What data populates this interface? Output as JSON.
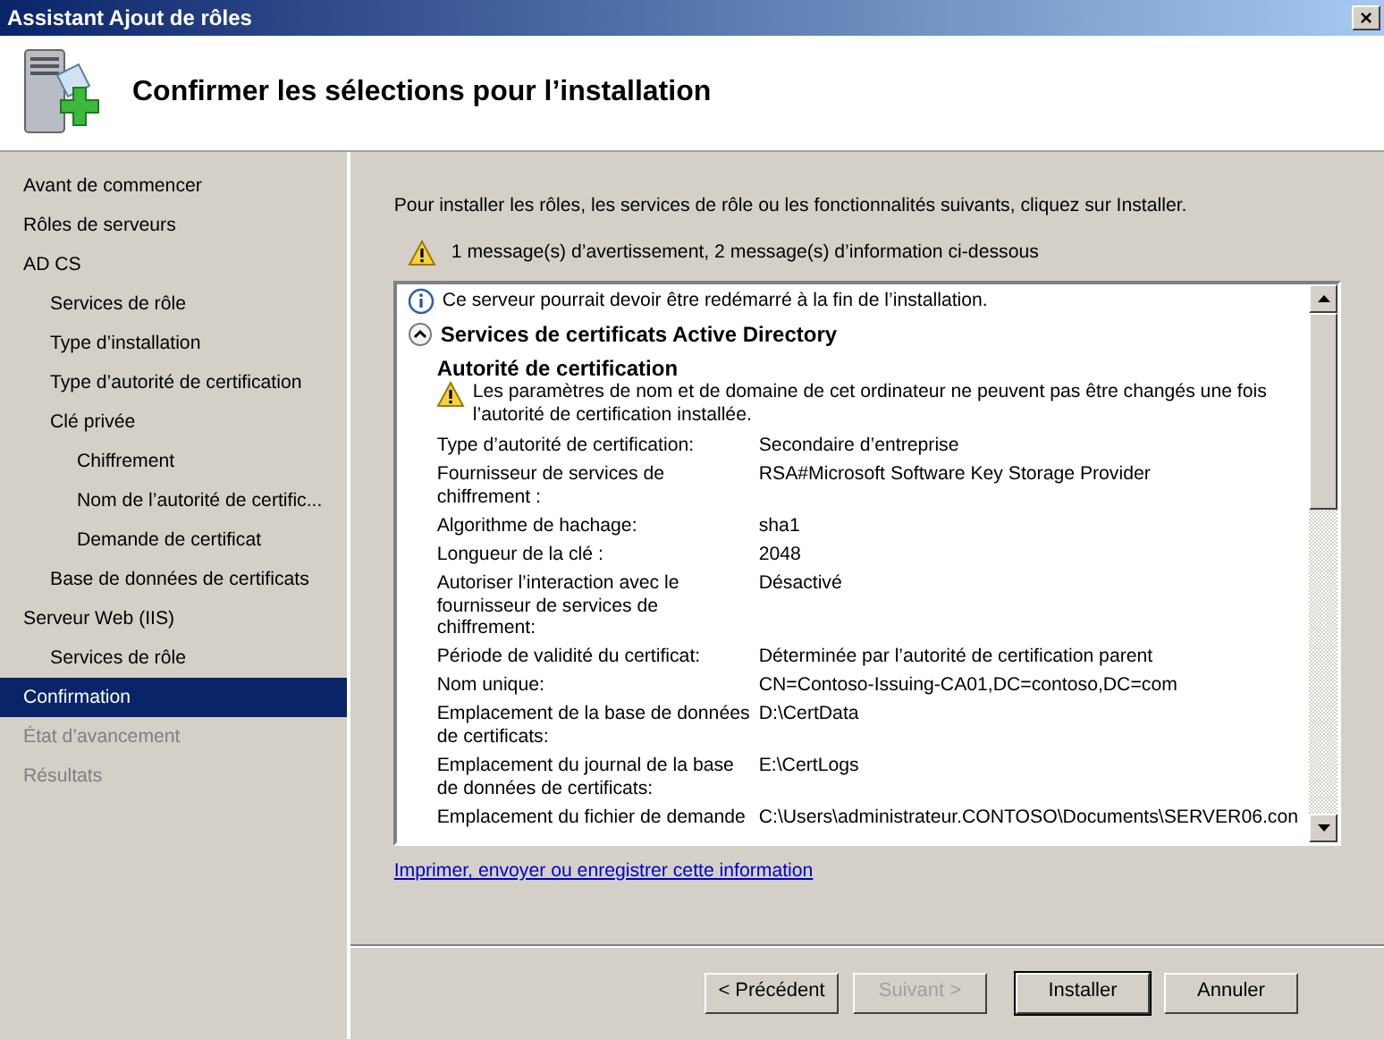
{
  "window": {
    "title": "Assistant Ajout de rôles",
    "close": "×"
  },
  "header": {
    "title": "Confirmer les sélections pour l’installation"
  },
  "sidebar": {
    "items": [
      {
        "label": "Avant de commencer",
        "selected": false,
        "disabled": false
      },
      {
        "label": "Rôles de serveurs",
        "selected": false,
        "disabled": false
      },
      {
        "label": "AD CS",
        "selected": false,
        "disabled": false,
        "children": [
          {
            "label": "Services de rôle",
            "selected": false,
            "disabled": false
          },
          {
            "label": "Type d’installation",
            "selected": false,
            "disabled": false
          },
          {
            "label": "Type d’autorité de certification",
            "selected": false,
            "disabled": false
          },
          {
            "label": "Clé privée",
            "selected": false,
            "disabled": false,
            "children": [
              {
                "label": "Chiffrement",
                "selected": false,
                "disabled": false
              },
              {
                "label": "Nom de l’autorité de certific...",
                "selected": false,
                "disabled": false
              },
              {
                "label": "Demande de certificat",
                "selected": false,
                "disabled": false
              }
            ]
          },
          {
            "label": "Base de données de certificats",
            "selected": false,
            "disabled": false
          }
        ]
      },
      {
        "label": "Serveur Web (IIS)",
        "selected": false,
        "disabled": false,
        "children": [
          {
            "label": "Services de rôle",
            "selected": false,
            "disabled": false
          }
        ]
      },
      {
        "label": "Confirmation",
        "selected": true,
        "disabled": false
      },
      {
        "label": "État d’avancement",
        "selected": false,
        "disabled": true
      },
      {
        "label": "Résultats",
        "selected": false,
        "disabled": true
      }
    ]
  },
  "content": {
    "intro": "Pour installer les rôles, les services de rôle ou les fonctionnalités suivants, cliquez sur Installer.",
    "summary": "1 message(s) d’avertissement, 2 message(s) d’information ci-dessous",
    "details": {
      "info": "Ce serveur pourrait devoir être redémarré à la fin de l’installation.",
      "section": {
        "title": "Services de certificats Active Directory",
        "expanded": true
      },
      "subsection": "Autorité de certification",
      "warning": "Les paramètres de nom et de domaine de cet ordinateur ne peuvent pas être changés une fois l’autorité de certification installée.",
      "rows": [
        {
          "label": "Type d’autorité de certification:",
          "value": "Secondaire d’entreprise"
        },
        {
          "label": "Fournisseur de services de chiffrement :",
          "value": "RSA#Microsoft Software Key Storage Provider"
        },
        {
          "label": "Algorithme de hachage:",
          "value": "sha1"
        },
        {
          "label": "Longueur de la clé :",
          "value": "2048"
        },
        {
          "label": "Autoriser l’interaction avec le fournisseur de services de chiffrement:",
          "value": "Désactivé"
        },
        {
          "label": "Période de validité du certificat:",
          "value": "Déterminée par l’autorité de certification parent"
        },
        {
          "label": "Nom unique:",
          "value": "CN=Contoso-Issuing-CA01,DC=contoso,DC=com"
        },
        {
          "label": "Emplacement de la base de données de certificats:",
          "value": "D:\\CertData"
        },
        {
          "label": "Emplacement du journal de la base de données de certificats:",
          "value": "E:\\CertLogs"
        },
        {
          "label": "Emplacement du fichier de demande",
          "value": "C:\\Users\\administrateur.CONTOSO\\Documents\\SERVER06.con"
        }
      ]
    },
    "link": "Imprimer, envoyer ou enregistrer cette information"
  },
  "buttons": [
    {
      "label": "< Précédent",
      "disabled": false,
      "default": false
    },
    {
      "label": "Suivant >",
      "disabled": true,
      "default": false
    },
    {
      "label": "Installer",
      "disabled": false,
      "default": true
    },
    {
      "label": "Annuler",
      "disabled": false,
      "default": false
    }
  ]
}
